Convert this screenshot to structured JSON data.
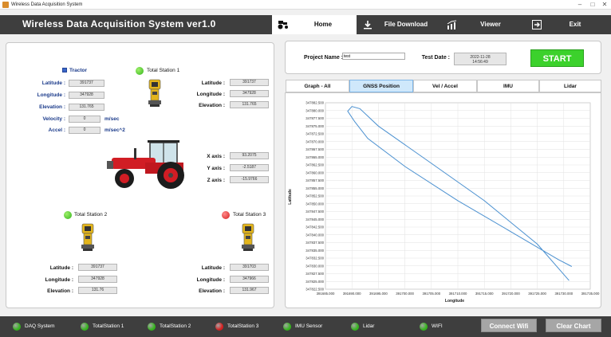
{
  "window": {
    "title": "Wireless Data Acquisition System"
  },
  "header": {
    "title": "Wireless Data Acquisition System ver1.0"
  },
  "nav": {
    "home": "Home",
    "file_download": "File Download",
    "viewer": "Viewer",
    "exit": "Exit"
  },
  "project": {
    "label": "Project Name :",
    "value": "test",
    "date_label": "Test Date :",
    "date_line1": "2022-11-28",
    "date_line2": "14:56:49",
    "start": "START"
  },
  "tractor": {
    "checkbox": "Tractor",
    "latitude_label": "Latitude :",
    "latitude": "391737",
    "longitude_label": "Longitude :",
    "longitude": "347928",
    "elevation_label": "Elevation :",
    "elevation": "131.765",
    "velocity_label": "Velocity :",
    "velocity": "0",
    "velocity_unit": "m/sec",
    "accel_label": "Accel :",
    "accel": "0",
    "accel_unit": "m/sec^2",
    "x_label": "X axis :",
    "x": "93.2075",
    "y_label": "Y axis :",
    "y": "-2.5187",
    "z_label": "Z axis :",
    "z": "-15.9766"
  },
  "ts1": {
    "name": "Total Station 1",
    "latitude_label": "Latitude :",
    "latitude": "391737",
    "longitude_label": "Longitude :",
    "longitude": "347928",
    "elevation_label": "Elevation :",
    "elevation": "131.765"
  },
  "ts2": {
    "name": "Total Station 2",
    "latitude_label": "Latitude :",
    "latitude": "391737",
    "longitude_label": "Longitude :",
    "longitude": "347928",
    "elevation_label": "Elevation :",
    "elevation": "131.76"
  },
  "ts3": {
    "name": "Total Station 3",
    "latitude_label": "Latitude :",
    "latitude": "391703",
    "longitude_label": "Longitude :",
    "longitude": "347966",
    "elevation_label": "Elevation :",
    "elevation": "131.967"
  },
  "tabs": [
    "Graph - All",
    "GNSS Position",
    "Vel / Accel",
    "IMU",
    "Lidar"
  ],
  "status": {
    "items": [
      {
        "label": "DAQ System",
        "color": "#34b41c"
      },
      {
        "label": "TotalStation 1",
        "color": "#34b41c"
      },
      {
        "label": "TotalStation 2",
        "color": "#34b41c"
      },
      {
        "label": "TotalStation 3",
        "color": "#d61e1e"
      },
      {
        "label": "IMU Sensor",
        "color": "#34b41c"
      },
      {
        "label": "Lidar",
        "color": "#34b41c"
      },
      {
        "label": "WIFI",
        "color": "#34b41c"
      }
    ],
    "connect_wifi": "Connect Wifi",
    "clear_chart": "Clear Chart"
  },
  "chart_data": {
    "type": "line",
    "title": "",
    "xlabel": "Longitude",
    "ylabel": "Latitude",
    "xlim": [
      391685,
      391735
    ],
    "ylim": [
      347822.5,
      347882.5
    ],
    "xticks": [
      "391685.000",
      "391690.000",
      "391695.000",
      "391700.000",
      "391705.000",
      "391710.000",
      "391715.000",
      "391720.000",
      "391725.000",
      "391730.000",
      "391735.000"
    ],
    "yticks": [
      "347822.500",
      "347825.000",
      "347827.500",
      "347830.000",
      "347832.500",
      "347835.000",
      "347837.500",
      "347840.000",
      "347842.500",
      "347845.000",
      "347847.500",
      "347850.000",
      "347852.500",
      "347855.000",
      "347857.500",
      "347860.000",
      "347862.500",
      "347865.000",
      "347867.500",
      "347870.000",
      "347872.500",
      "347875.000",
      "347877.500",
      "347880.000",
      "347882.500"
    ],
    "grid": true,
    "color": "#4a90d0",
    "x": [
      391731.5,
      391729.0,
      391720.0,
      391710.0,
      391700.0,
      391693.0,
      391690.5,
      391689.2,
      391690.0,
      391691.5,
      391695.0,
      391705.0,
      391715.0,
      391725.0,
      391731.0
    ],
    "y": [
      347829.8,
      347832.0,
      347841.0,
      347851.0,
      347862.0,
      347871.0,
      347876.5,
      347879.8,
      347881.3,
      347880.6,
      347875.0,
      347863.0,
      347851.0,
      347837.0,
      347825.3
    ]
  }
}
